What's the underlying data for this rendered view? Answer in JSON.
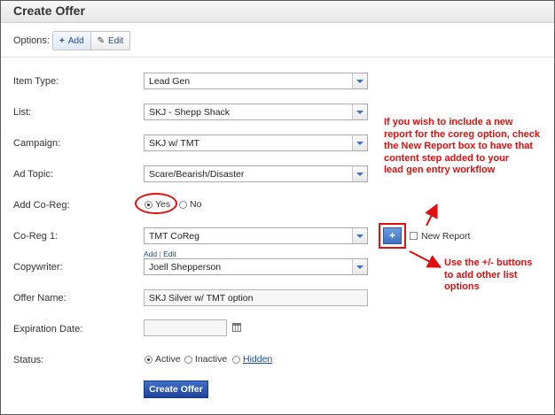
{
  "header": {
    "title": "Create Offer"
  },
  "options": {
    "label": "Options:",
    "add_label": "Add",
    "edit_label": "Edit"
  },
  "form": {
    "item_type": {
      "label": "Item Type:",
      "value": "Lead Gen"
    },
    "list": {
      "label": "List:",
      "value": "SKJ - Shepp Shack"
    },
    "campaign": {
      "label": "Campaign:",
      "value": "SKJ w/ TMT"
    },
    "ad_topic": {
      "label": "Ad Topic:",
      "value": "Scare/Bearish/Disaster"
    },
    "add_coreg": {
      "label": "Add Co-Reg:",
      "yes": "Yes",
      "no": "No",
      "selected": "Yes"
    },
    "coreg1": {
      "label": "Co-Reg 1:",
      "value": "TMT CoReg",
      "plus_label": "+",
      "new_report_label": "New Report",
      "add_link": "Add",
      "separator": "|",
      "edit_link": "Edit"
    },
    "copywriter": {
      "label": "Copywriter:",
      "value": "Joell Shepperson"
    },
    "offer_name": {
      "label": "Offer Name:",
      "value": "SKJ Silver w/ TMT option"
    },
    "expiration_date": {
      "label": "Expiration Date:",
      "value": ""
    },
    "status": {
      "label": "Status:",
      "active": "Active",
      "inactive": "Inactive",
      "hidden": "Hidden",
      "selected": "Active"
    },
    "submit_label": "Create Offer"
  },
  "annotations": {
    "top_lines": [
      "If you wish to include a new",
      "report for the coreg option, check",
      "the New Report box to have that",
      "content step added to your",
      "lead gen entry workflow"
    ],
    "bottom_lines": [
      "Use the +/- buttons",
      "to add other list",
      "options"
    ]
  },
  "colors": {
    "accent": "#1f4b99",
    "annotation": "#e01010",
    "primary_button": "#2a55ab"
  }
}
